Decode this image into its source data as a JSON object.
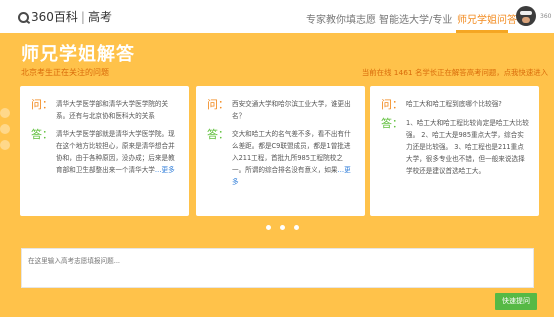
{
  "header": {
    "logo_brand": "360百科",
    "logo_sep": "|",
    "logo_sub": "高考",
    "nav": [
      "专家教你填志愿",
      "智能选大学/专业",
      "师兄学姐问答"
    ],
    "active_nav": 2,
    "user_name": "360"
  },
  "page": {
    "title": "师兄学姐解答",
    "section_label": "北京考生正在关注的问题",
    "stats": "当前在线 1461 名学长正在解答高考问题，点我快速进入"
  },
  "cards": [
    {
      "q_label": "问：",
      "question": "清华大学医学部和清华大学医学院的关系。还有与北京协和医科大的关系",
      "a_label": "答：",
      "answer": "清华大学医学部就是清华大学医学院。现在这个地方比较担心，原来是清华想合并协和，由于各种原因，没办成；后来是教育部和卫生部整出来一个清华大学",
      "more": "…更多"
    },
    {
      "q_label": "问：",
      "question": "西安交通大学和哈尔滨工业大学，谁更出名？",
      "a_label": "答：",
      "answer": "交大和哈工大的名气差不多，看不出有什么差距。都是C9联盟成员，都是1曾批进入211工程，首批九所985工程院校之一。所谓的综合排名没有意义，如果",
      "more": "…更多"
    },
    {
      "q_label": "问：",
      "question": "哈工大和哈工程到底哪个比较强?",
      "a_label": "答：",
      "answer": "1、哈工大和哈工程比较肯定是哈工大比较强。 2、哈工大是985重点大学，综合实力还是比较强。 3、哈工程也是211重点大学，很多专业也不错，但一般来说选择学校还是建议首选哈工大。",
      "more": ""
    }
  ],
  "pagination": {
    "count": 3
  },
  "ask": {
    "placeholder": "在这里输入高考志愿填报问题...",
    "submit_label": "快速提问"
  },
  "colors": {
    "background": "#ffc24a",
    "accent_orange": "#f28a1e",
    "answer_green": "#5fbf3b",
    "submit_green": "#56b945",
    "link_blue": "#2a7ad8"
  }
}
